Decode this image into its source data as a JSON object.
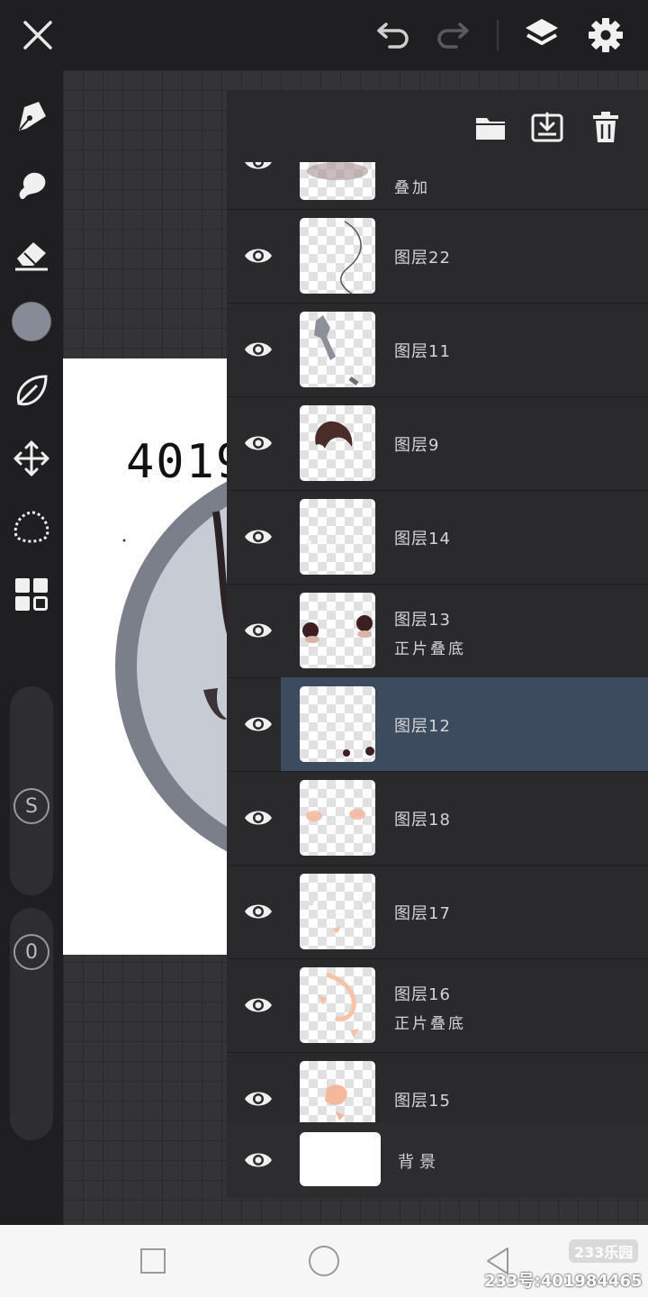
{
  "toolbar": {
    "close_icon": "close-icon",
    "undo_icon": "undo-icon",
    "redo_icon": "redo-icon",
    "layers_icon": "layers-icon",
    "settings_icon": "gear-icon"
  },
  "tools": [
    "pen-icon",
    "smudge-icon",
    "eraser-icon",
    "color-swatch",
    "leaf-icon",
    "move-icon",
    "lasso-icon",
    "grid-icon"
  ],
  "sliders": {
    "size_label": "S",
    "opacity_label": "0"
  },
  "colors": {
    "current_color": "#868b97",
    "selected_row": "#3c4b5e",
    "panel_bg": "#2a2a2d"
  },
  "canvas": {
    "visible_number": "4019"
  },
  "panel_header": {
    "folder_icon": "folder-icon",
    "import_icon": "import-icon",
    "delete_icon": "trash-icon"
  },
  "layers": [
    {
      "name": "",
      "mode": "叠加"
    },
    {
      "name": "图层22",
      "mode": ""
    },
    {
      "name": "图层11",
      "mode": ""
    },
    {
      "name": "图层9",
      "mode": ""
    },
    {
      "name": "图层14",
      "mode": ""
    },
    {
      "name": "图层13",
      "mode": "正片叠底"
    },
    {
      "name": "图层12",
      "mode": ""
    },
    {
      "name": "图层18",
      "mode": ""
    },
    {
      "name": "图层17",
      "mode": ""
    },
    {
      "name": "图层16",
      "mode": "正片叠底"
    },
    {
      "name": "图层15",
      "mode": ""
    }
  ],
  "background_layer": {
    "name": "背景"
  },
  "watermark": {
    "logo": "233乐园",
    "id": "233号:401984465"
  }
}
